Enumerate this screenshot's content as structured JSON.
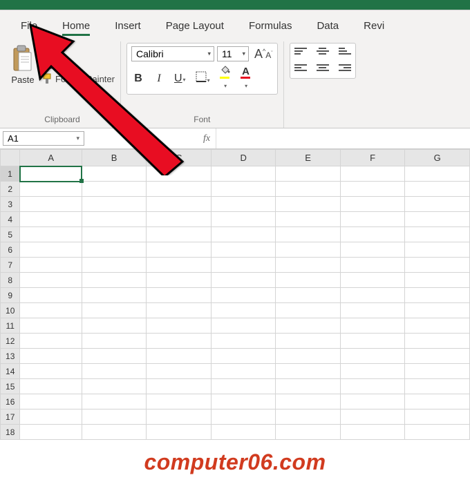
{
  "tabs": {
    "file": "File",
    "home": "Home",
    "insert": "Insert",
    "page_layout": "Page Layout",
    "formulas": "Formulas",
    "data": "Data",
    "review": "Revi"
  },
  "clipboard": {
    "paste": "Paste",
    "format_painter": "Format Painter",
    "group_label": "Clipboard"
  },
  "font": {
    "name": "Calibri",
    "size": "11",
    "bold": "B",
    "italic": "I",
    "underline": "U",
    "group_label": "Font"
  },
  "namebox": {
    "cell_ref": "A1",
    "fx": "fx"
  },
  "columns": [
    "A",
    "B",
    "C",
    "D",
    "E",
    "F",
    "G"
  ],
  "rows": [
    "1",
    "2",
    "3",
    "4",
    "5",
    "6",
    "7",
    "8",
    "9",
    "10",
    "11",
    "12",
    "13",
    "14",
    "15",
    "16",
    "17",
    "18"
  ],
  "watermark": "computer06.com"
}
